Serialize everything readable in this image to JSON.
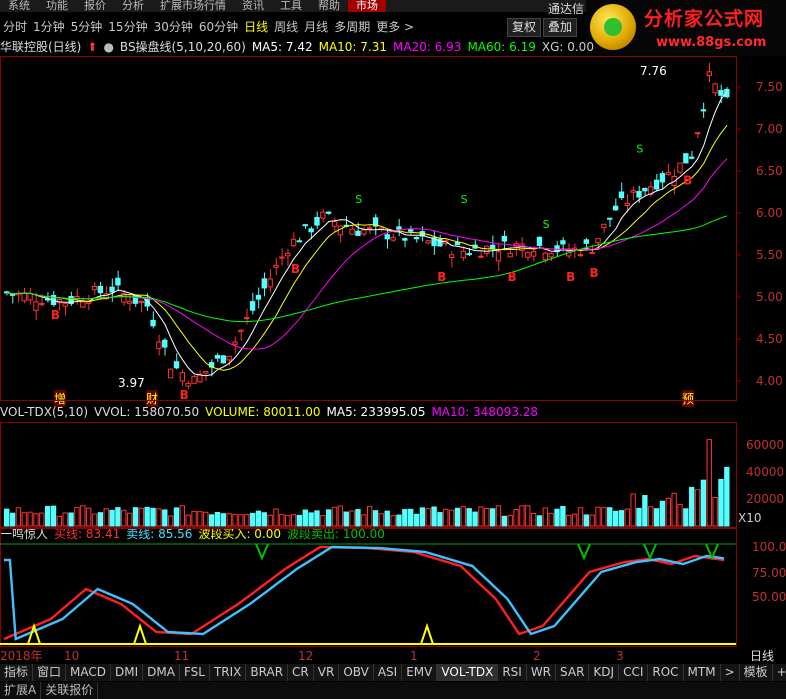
{
  "menu": {
    "items": [
      "系统",
      "功能",
      "报价",
      "分析",
      "扩展市场行情",
      "资讯",
      "工具",
      "帮助",
      "市场"
    ],
    "active_index": 8
  },
  "periods": {
    "items": [
      "分时",
      "1分钟",
      "5分钟",
      "15分钟",
      "30分钟",
      "60分钟",
      "日线",
      "周线",
      "月线",
      "多周期",
      "更多 >"
    ],
    "selected": "日线"
  },
  "toolbar": {
    "review": "复权",
    "add": "叠加",
    "extra": "通达信"
  },
  "logo": {
    "name": "分析家公式网",
    "url": "www.88gs.com"
  },
  "main_legend": {
    "stock": "华联控股(日线)",
    "indicator": "BS操盘线(5,10,20,60)",
    "ma5": "MA5: 7.42",
    "ma10": "MA10: 7.31",
    "ma20": "MA20: 6.93",
    "ma60": "MA60: 6.19",
    "xg": "XG: 0.00"
  },
  "price_axis": [
    "7.50",
    "7.00",
    "6.50",
    "6.00",
    "5.50",
    "5.00",
    "4.50",
    "4.00"
  ],
  "annotations": {
    "high": "7.76",
    "low": "3.97",
    "zeng": "增",
    "cai": "财",
    "yu": "预"
  },
  "vol_legend": {
    "name": "VOL-TDX(5,10)",
    "vvol": "VVOL: 158070.50",
    "volume": "VOLUME: 80011.00",
    "ma5": "MA5: 233995.05",
    "ma10": "MA10: 348093.28"
  },
  "vol_axis": [
    "60000",
    "40000",
    "20000"
  ],
  "vol_unit": "X10",
  "osc_legend": {
    "name": "一鸣惊人",
    "buy": "买线: 83.41",
    "sell": "卖线: 85.56",
    "wave_buy": "波段买入: 0.00",
    "wave_sell": "波段卖出: 100.00"
  },
  "osc_axis": [
    "100.0",
    "75.00",
    "50.00"
  ],
  "time_axis": {
    "year": "2018年",
    "m10": "10",
    "m11": "11",
    "m12": "12",
    "m1": "1",
    "m2": "2",
    "m3": "3",
    "period": "日线"
  },
  "bottom_tabs": [
    "指标",
    "窗口",
    "MACD",
    "DMI",
    "DMA",
    "FSL",
    "TRIX",
    "BRAR",
    "CR",
    "VR",
    "OBV",
    "ASI",
    "EMV",
    "VOL-TDX",
    "RSI",
    "WR",
    "SAR",
    "KDJ",
    "CCI",
    "ROC",
    "MTM",
    ">",
    "模板",
    "+",
    "-"
  ],
  "status": [
    "扩展A",
    "关联报价"
  ],
  "colors": {
    "up": "#ff3232",
    "down": "#54ffff",
    "ma5": "#ffffff",
    "ma10": "#ffff00",
    "ma20": "#ff00ff",
    "ma60": "#00ff00",
    "grid": "#8b0000"
  },
  "icons": [
    "arrow-up-icon",
    "circle-menu-icon",
    "logo-badge-icon"
  ]
}
